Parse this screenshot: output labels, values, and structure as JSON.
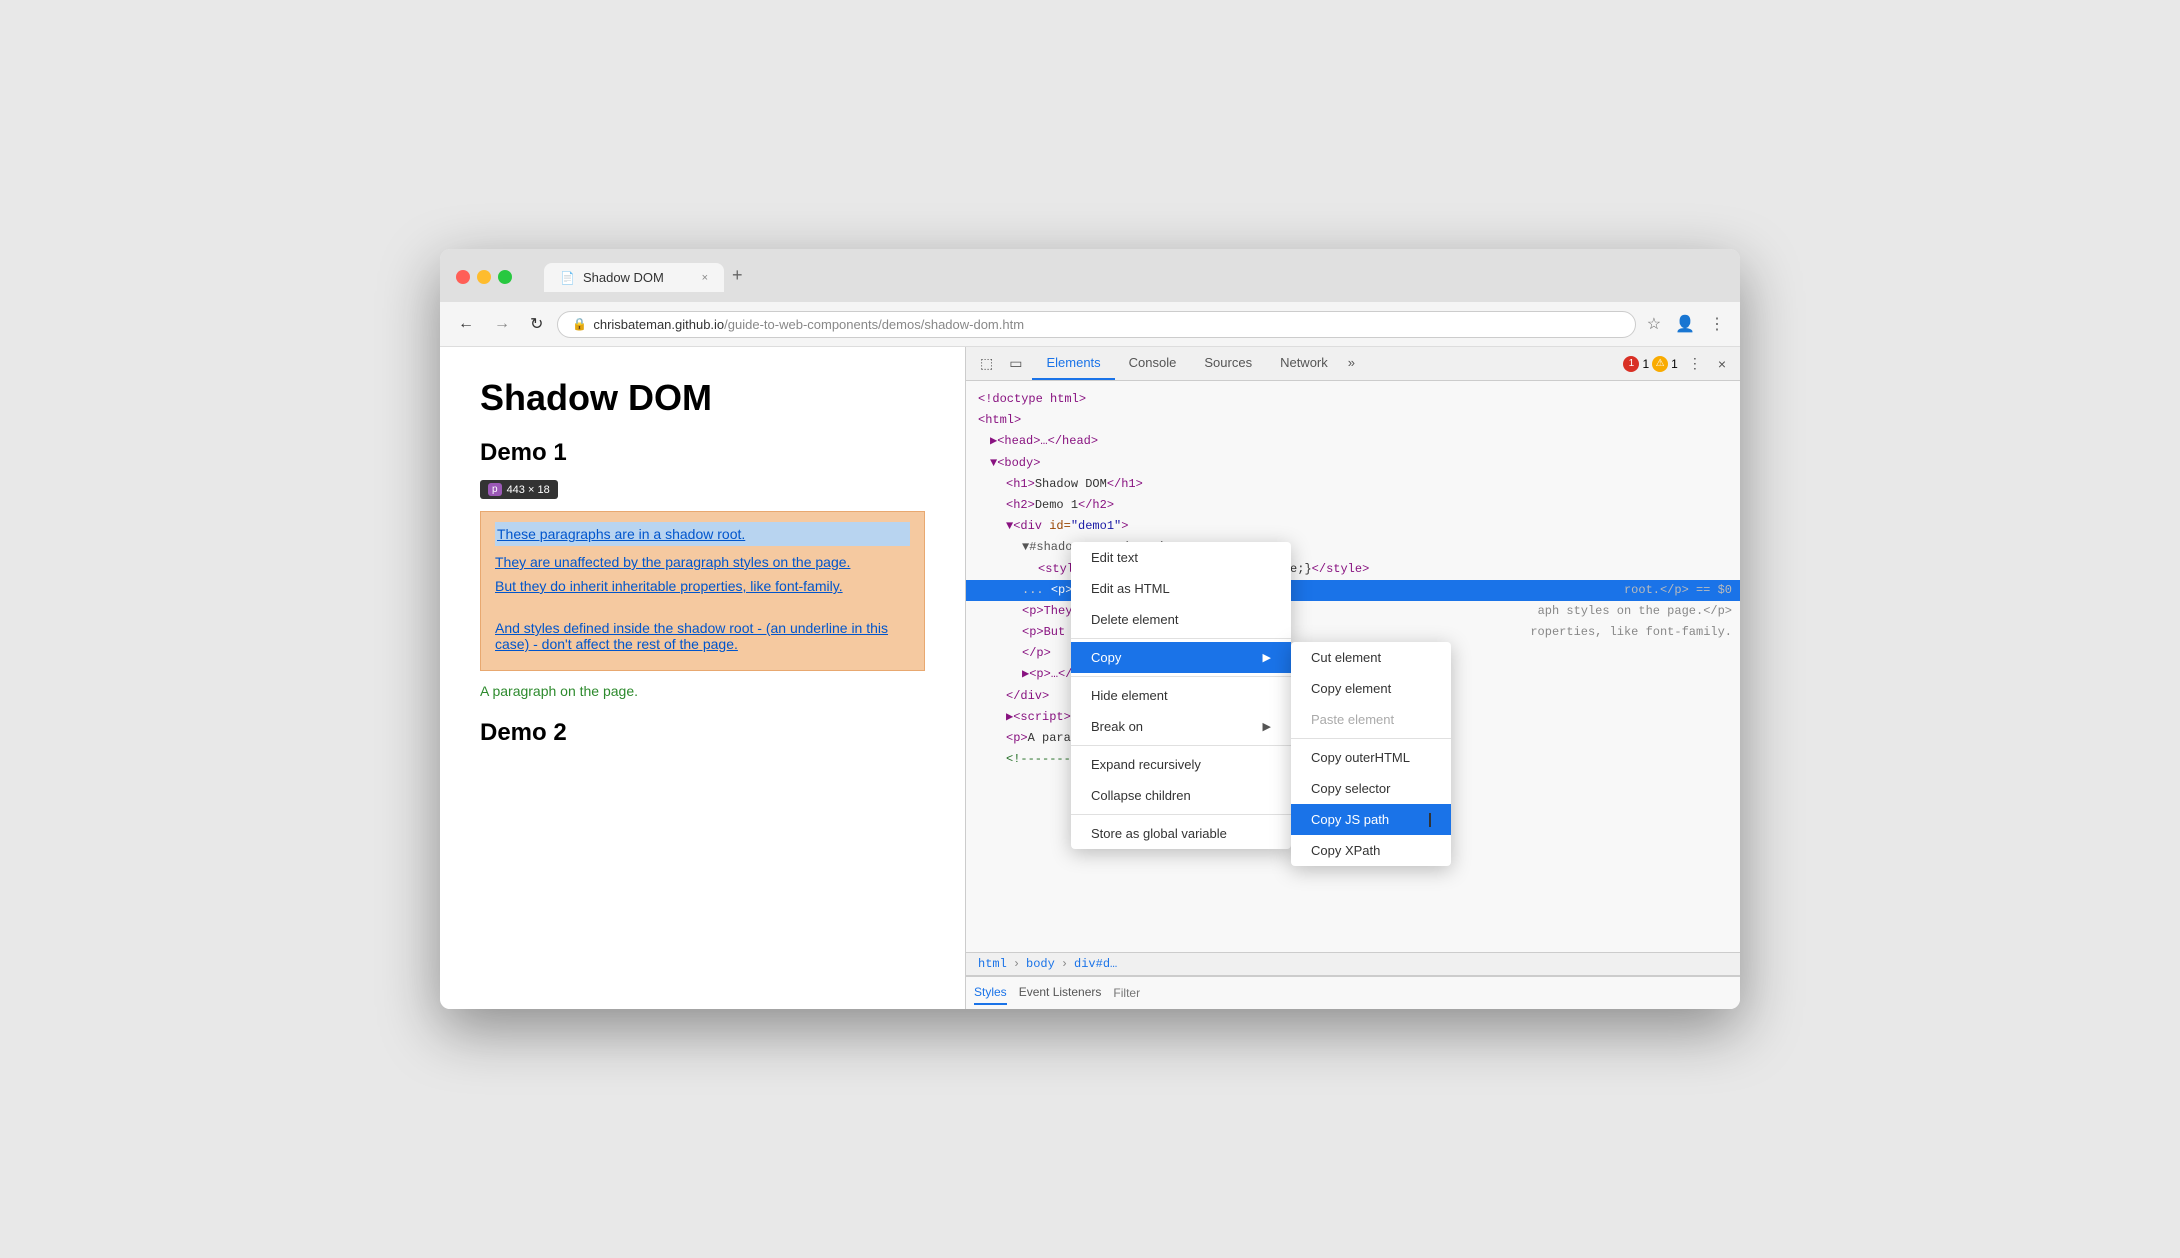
{
  "browser": {
    "traffic_lights": [
      "red",
      "yellow",
      "green"
    ],
    "tab": {
      "icon": "📄",
      "title": "Shadow DOM",
      "close": "×"
    },
    "new_tab": "+",
    "nav": {
      "back": "←",
      "forward": "→",
      "reload": "↻",
      "url_lock": "🔒",
      "url_host": "chrisbateman.github.io",
      "url_path": "/guide-to-web-components/demos/shadow-dom.htm",
      "bookmark": "☆",
      "avatar": "👤",
      "more": "⋮"
    }
  },
  "page": {
    "title": "Shadow DOM",
    "demo1_heading": "Demo 1",
    "tooltip_badge": "p",
    "tooltip_size": "443 × 18",
    "shadow_paragraph1": "These paragraphs are in a shadow root.",
    "shadow_paragraph2": "They are unaffected by the paragraph styles on the page.",
    "shadow_paragraph3": "But they do inherit inheritable properties, like font-family.",
    "shadow_paragraph4": "And styles defined inside the shadow root - (an underline in this case) - don't affect the rest of the page.",
    "green_paragraph": "A paragraph on the page.",
    "demo2_heading": "Demo 2"
  },
  "devtools": {
    "toolbar": {
      "inspect_icon": "⬚",
      "device_icon": "▭",
      "close_icon": "×"
    },
    "tabs": [
      "Elements",
      "Console",
      "Sources",
      "Network"
    ],
    "active_tab": "Elements",
    "more_tabs": "»",
    "error_count": "1",
    "warning_count": "1",
    "menu_icon": "⋮"
  },
  "elements_tree": {
    "lines": [
      {
        "text": "<!doctype html>",
        "indent": 0,
        "type": "comment"
      },
      {
        "text": "<html>",
        "indent": 0,
        "type": "tag"
      },
      {
        "text": "▶<head>…</head>",
        "indent": 1,
        "type": "tag"
      },
      {
        "text": "▼<body>",
        "indent": 1,
        "type": "tag"
      },
      {
        "text": "<h1>Shadow DOM</h1>",
        "indent": 2,
        "type": "tag"
      },
      {
        "text": "<h2>Demo 1</h2>",
        "indent": 2,
        "type": "tag"
      },
      {
        "text": "▼<div id=\"demo1\">",
        "indent": 2,
        "type": "tag"
      },
      {
        "text": "▼#shadow-root (open)",
        "indent": 3,
        "type": "special"
      },
      {
        "text": "<style>p {text-decoration: underline;}</style>",
        "indent": 4,
        "type": "tag"
      },
      {
        "text": "...",
        "indent": 3,
        "type": "ellipsis",
        "selected": true,
        "rhs": "root.</p> == $0"
      },
      {
        "text": "<p>They …",
        "indent": 3,
        "type": "tag",
        "rhs": "aph styles on the page.</p>"
      },
      {
        "text": "<p>But i…",
        "indent": 3,
        "type": "tag",
        "rhs": "roperties, like font-family."
      },
      {
        "text": "</p>",
        "indent": 3,
        "type": "tag"
      },
      {
        "text": "▶<p>…</p>",
        "indent": 3,
        "type": "tag"
      },
      {
        "text": "</div>",
        "indent": 2,
        "type": "tag"
      },
      {
        "text": "▶<script>…</",
        "indent": 2,
        "type": "tag"
      },
      {
        "text": "<p>A parag…",
        "indent": 2,
        "type": "tag"
      },
      {
        "text": "<!---------",
        "indent": 2,
        "type": "comment"
      }
    ]
  },
  "breadcrumb": {
    "items": [
      "html",
      "body",
      "div#d…"
    ]
  },
  "bottom_panel": {
    "tabs": [
      "Styles",
      "Event Listeners"
    ],
    "active_tab": "Styles",
    "filter_placeholder": "Filter"
  },
  "context_menu": {
    "items": [
      {
        "label": "Edit text",
        "type": "item"
      },
      {
        "label": "Edit as HTML",
        "type": "item"
      },
      {
        "label": "Delete element",
        "type": "item"
      },
      {
        "label": "Copy",
        "type": "submenu",
        "highlighted": true
      },
      {
        "label": "Hide element",
        "type": "item"
      },
      {
        "label": "Break on",
        "type": "submenu"
      },
      {
        "label": "Expand recursively",
        "type": "item"
      },
      {
        "label": "Collapse children",
        "type": "item"
      },
      {
        "label": "Store as global variable",
        "type": "item"
      }
    ],
    "submenu_items": [
      {
        "label": "Cut element",
        "type": "item"
      },
      {
        "label": "Copy element",
        "type": "item"
      },
      {
        "label": "Paste element",
        "type": "item",
        "disabled": true
      },
      {
        "label": "Copy outerHTML",
        "type": "item"
      },
      {
        "label": "Copy selector",
        "type": "item"
      },
      {
        "label": "Copy JS path",
        "type": "item",
        "highlighted": true
      },
      {
        "label": "Copy XPath",
        "type": "item"
      }
    ]
  }
}
